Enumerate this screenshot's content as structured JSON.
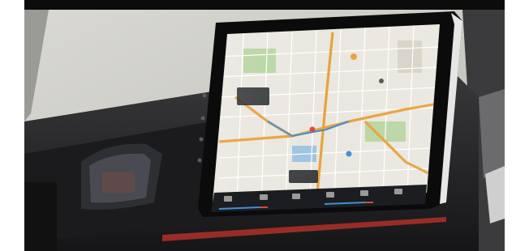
{
  "photo": {
    "subject": "car-dashboard-infotainment-display",
    "colors": {
      "top_band": "#0c0c0c",
      "windshield": "#cfcfca",
      "dashboard": "#2a2a2c",
      "dash_dark": "#141416",
      "screen_bezel": "#0b0b0c",
      "map_bg": "#e9e7df",
      "map_road_major": "#e9a23b",
      "map_road_minor": "#ffffff",
      "map_park": "#b9d6a4",
      "map_water": "#9fc4e0",
      "accent_blue": "#3f8fd6",
      "accent_red": "#d64a3f",
      "ambient_red": "#b8322a",
      "chrome": "#e6e6e6"
    }
  },
  "screen": {
    "bottom_bar_icons": [
      "home-icon",
      "navigation-icon",
      "music-icon",
      "phone-icon",
      "apps-icon",
      "climate-icon"
    ],
    "map_markers": [
      "map-pin-icon",
      "map-pin-icon",
      "map-pin-icon",
      "map-pin-icon"
    ]
  }
}
